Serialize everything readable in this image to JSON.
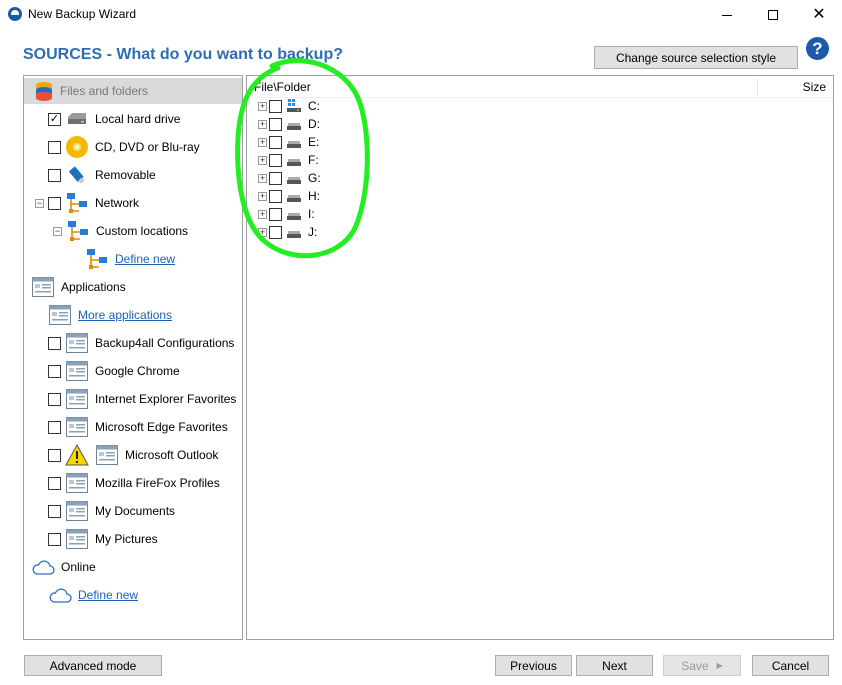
{
  "window": {
    "title": "New Backup Wizard",
    "minimize_glyph": "",
    "maximize_glyph": "",
    "close_glyph": "✕"
  },
  "header": {
    "title": "SOURCES - What do you want to backup?",
    "change_style_label": "Change source selection style",
    "help_glyph": "?"
  },
  "colors": {
    "accent": "#2e6db4",
    "link": "#1f5fb5",
    "annotation": "#22ee22"
  },
  "sources": {
    "files_header": "Files and folders",
    "local_drive": {
      "label": "Local hard drive",
      "checked": true,
      "icon": "hard-drive-icon"
    },
    "optical": {
      "label": "CD, DVD or Blu-ray",
      "checked": false,
      "icon": "optical-disc-icon"
    },
    "removable": {
      "label": "Removable",
      "checked": false,
      "icon": "usb-drive-icon"
    },
    "network": {
      "label": "Network",
      "checked": false,
      "expander": "−",
      "icon": "network-icon"
    },
    "custom_locations": {
      "label": "Custom locations",
      "expander": "−",
      "icon": "network-icon"
    },
    "define_new_network": "Define new",
    "applications_header": "Applications",
    "more_applications": "More applications",
    "apps": [
      {
        "label": "Backup4all Configurations",
        "checked": false
      },
      {
        "label": "Google Chrome",
        "checked": false
      },
      {
        "label": "Internet Explorer Favorites",
        "checked": false
      },
      {
        "label": "Microsoft Edge Favorites",
        "checked": false
      },
      {
        "label": "Microsoft Outlook",
        "checked": false,
        "warning": true
      },
      {
        "label": "Mozilla FireFox Profiles",
        "checked": false
      },
      {
        "label": "My Documents",
        "checked": false
      },
      {
        "label": "My Pictures",
        "checked": false
      }
    ],
    "online_header": "Online",
    "define_new_online": "Define new"
  },
  "file_tree": {
    "col_file": "File\\Folder",
    "col_size": "Size",
    "expander_glyph": "+",
    "drives": [
      {
        "label": "C:",
        "system": true
      },
      {
        "label": "D:",
        "system": false
      },
      {
        "label": "E:",
        "system": false
      },
      {
        "label": "F:",
        "system": false
      },
      {
        "label": "G:",
        "system": false
      },
      {
        "label": "H:",
        "system": false
      },
      {
        "label": "I:",
        "system": false
      },
      {
        "label": "J:",
        "system": false
      }
    ]
  },
  "footer": {
    "advanced": "Advanced mode",
    "previous": "Previous",
    "next": "Next",
    "save": "Save",
    "cancel": "Cancel"
  }
}
